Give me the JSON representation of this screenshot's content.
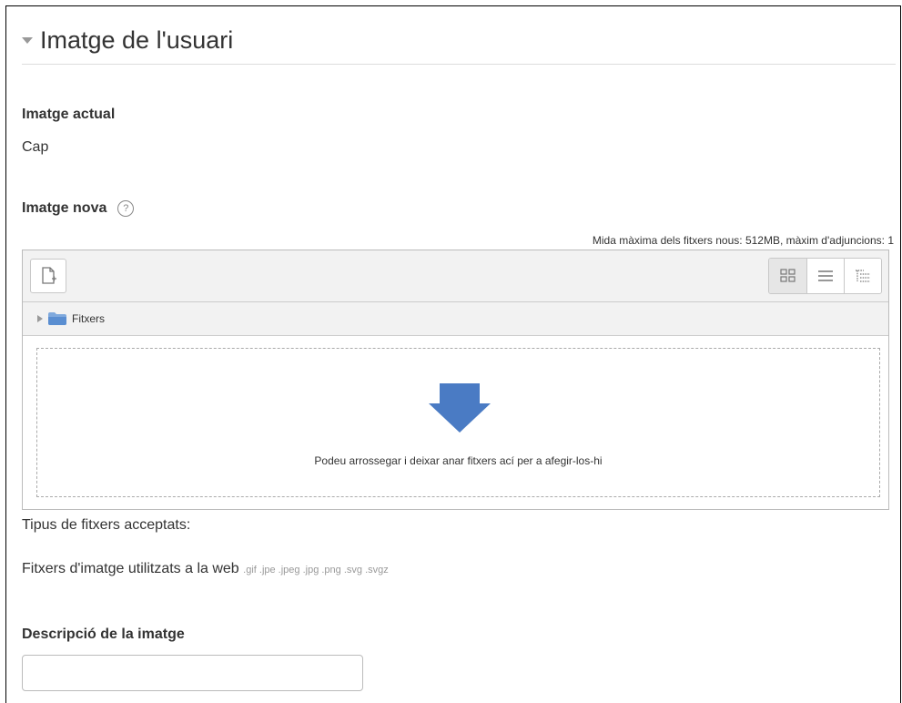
{
  "section": {
    "title": "Imatge de l'usuari"
  },
  "current_image": {
    "label": "Imatge actual",
    "value": "Cap"
  },
  "new_image": {
    "label": "Imatge nova",
    "help_glyph": "?",
    "max_size_text": "Mida màxima dels fitxers nous: 512MB, màxim d'adjuncions: 1"
  },
  "filepicker": {
    "icons": {
      "add_file": "add-file-icon",
      "view_icons": "grid-view-icon",
      "view_list": "list-view-icon",
      "view_tree": "tree-view-icon"
    },
    "path_label": "Fitxers",
    "drop_text": "Podeu arrossegar i deixar anar fitxers ací per a afegir-los-hi",
    "drop_arrow_color": "#4a7bc4"
  },
  "accepted": {
    "heading": "Tipus de fitxers acceptats:",
    "type_name": "Fitxers d'imatge utilitzats a la web",
    "extensions": ".gif .jpe .jpeg .jpg .png .svg .svgz"
  },
  "description": {
    "label": "Descripció de la imatge",
    "value": ""
  }
}
